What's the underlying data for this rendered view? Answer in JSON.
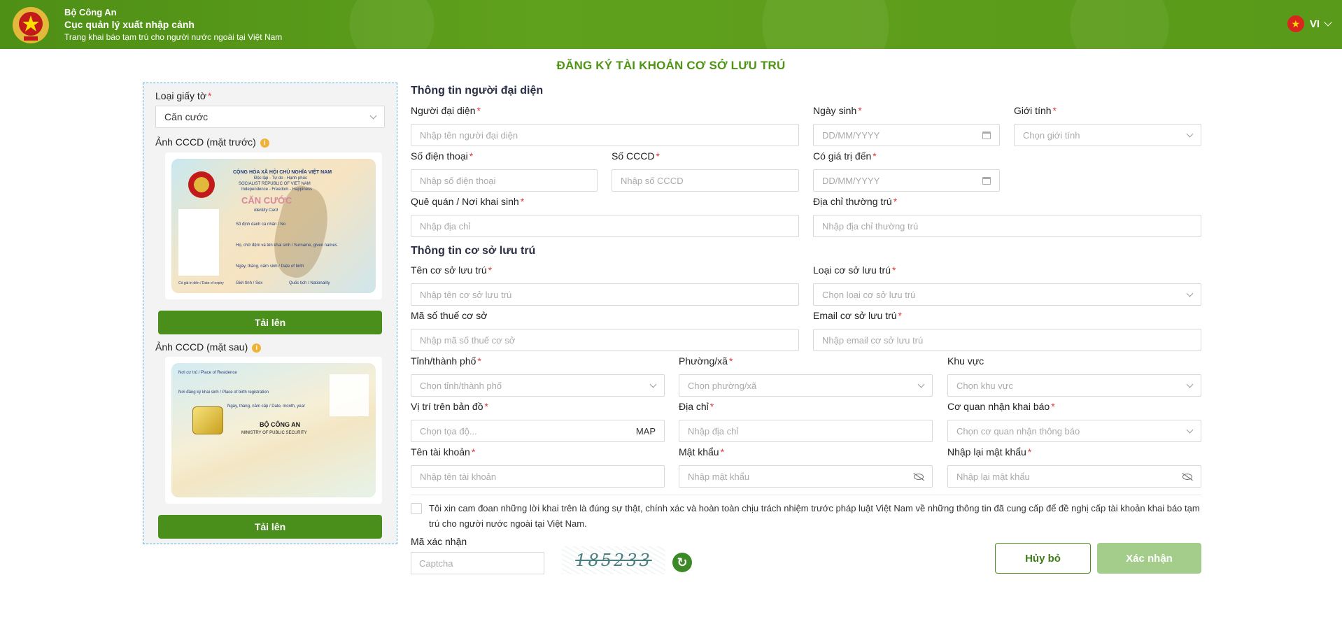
{
  "header": {
    "org_line1": "Bộ Công An",
    "org_line2": "Cục quản lý xuất nhập cảnh",
    "subtitle": "Trang khai báo tạm trú cho người nước ngoài tại Việt Nam",
    "language": "VI",
    "flag_star": "★"
  },
  "page_title": "ĐĂNG KÝ TÀI KHOẢN CƠ SỞ LƯU TRÚ",
  "left_panel": {
    "doc_type_label": "Loại giấy tờ",
    "doc_type_value": "Căn cước",
    "front_label": "Ảnh CCCD (mặt trước)",
    "back_label": "Ảnh CCCD (mặt sau)",
    "upload_label": "Tải lên",
    "info_glyph": "i",
    "front_card": {
      "line1": "CỘNG HÒA XÃ HỘI CHỦ NGHĨA VIỆT NAM",
      "line2": "Độc lập - Tự do - Hạnh phúc",
      "line3": "SOCIALIST REPUBLIC OF VIET NAM",
      "line4": "Independence - Freedom - Happiness",
      "title": "CĂN CƯỚC",
      "subtitle": "Identity Card",
      "f1": "Số định danh cá nhân / No",
      "f2": "Họ, chữ đệm và tên khai sinh / Surname, given names",
      "f3": "Ngày, tháng, năm sinh / Date of birth",
      "f4": "Giới tính / Sex",
      "f5": "Quốc tịch / Nationality",
      "f6": "Có giá trị đến / Date of expiry"
    },
    "back_card": {
      "b1": "Nơi cư trú / Place of Residence",
      "b2": "Nơi đăng ký khai sinh / Place of birth registration",
      "b3": "Ngày, tháng, năm cấp / Date, month, year",
      "b4": "BỘ CÔNG AN",
      "b5": "MINISTRY OF PUBLIC SECURITY"
    }
  },
  "representative": {
    "section_title": "Thông tin người đại diện",
    "name_label": "Người đại diện",
    "name_placeholder": "Nhập tên người đại diện",
    "dob_label": "Ngày sinh",
    "dob_placeholder": "DD/MM/YYYY",
    "gender_label": "Giới tính",
    "gender_placeholder": "Chọn giới tính",
    "phone_label": "Số điện thoại",
    "phone_placeholder": "Nhập số điện thoại",
    "cccd_label": "Số CCCD",
    "cccd_placeholder": "Nhập số CCCD",
    "expiry_label": "Có giá trị đến",
    "expiry_placeholder": "DD/MM/YYYY",
    "hometown_label": "Quê quán / Nơi khai sinh",
    "hometown_placeholder": "Nhập địa chỉ",
    "residence_label": "Địa chỉ thường trú",
    "residence_placeholder": "Nhập địa chỉ thường trú"
  },
  "accommodation": {
    "section_title": "Thông tin cơ sở lưu trú",
    "name_label": "Tên cơ sở lưu trú",
    "name_placeholder": "Nhập tên cơ sở lưu trú",
    "type_label": "Loại cơ sở lưu trú",
    "type_placeholder": "Chọn loại cơ sở lưu trú",
    "tax_label": "Mã số thuế cơ sở",
    "tax_placeholder": "Nhập mã số thuế cơ sở",
    "email_label": "Email cơ sở lưu trú",
    "email_placeholder": "Nhập email cơ sở lưu trú",
    "province_label": "Tỉnh/thành phố",
    "province_placeholder": "Chọn tỉnh/thành phố",
    "ward_label": "Phường/xã",
    "ward_placeholder": "Chọn phường/xã",
    "area_label": "Khu vực",
    "area_placeholder": "Chọn khu vực",
    "map_label": "Vị trí trên bản đồ",
    "map_placeholder": "Chọn tọa độ...",
    "map_button": "MAP",
    "address_label": "Địa chỉ",
    "address_placeholder": "Nhập địa chỉ",
    "agency_label": "Cơ quan nhận khai báo",
    "agency_placeholder": "Chọn cơ quan nhận thông báo",
    "username_label": "Tên tài khoản",
    "username_placeholder": "Nhập tên tài khoản",
    "password_label": "Mật khẩu",
    "password_placeholder": "Nhập mật khẩu",
    "repassword_label": "Nhập lại mật khẩu",
    "repassword_placeholder": "Nhập lại mật khẩu"
  },
  "consent_text": "Tôi xin cam đoan những lời khai trên là đúng sự thật, chính xác và hoàn toàn chịu trách nhiệm trước pháp luật Việt Nam về những thông tin đã cung cấp để đề nghị cấp tài khoản khai báo tạm trú cho người nước ngoài tại Việt Nam.",
  "captcha": {
    "label": "Mã xác nhận",
    "placeholder": "Captcha",
    "code": "185233",
    "refresh_glyph": "↻"
  },
  "actions": {
    "cancel": "Hủy bỏ",
    "confirm": "Xác nhận"
  },
  "colors": {
    "brand_green": "#5a9a1a",
    "button_green": "#4a8f1c",
    "disabled_green": "#a4cc8a",
    "required_red": "#e03838"
  }
}
